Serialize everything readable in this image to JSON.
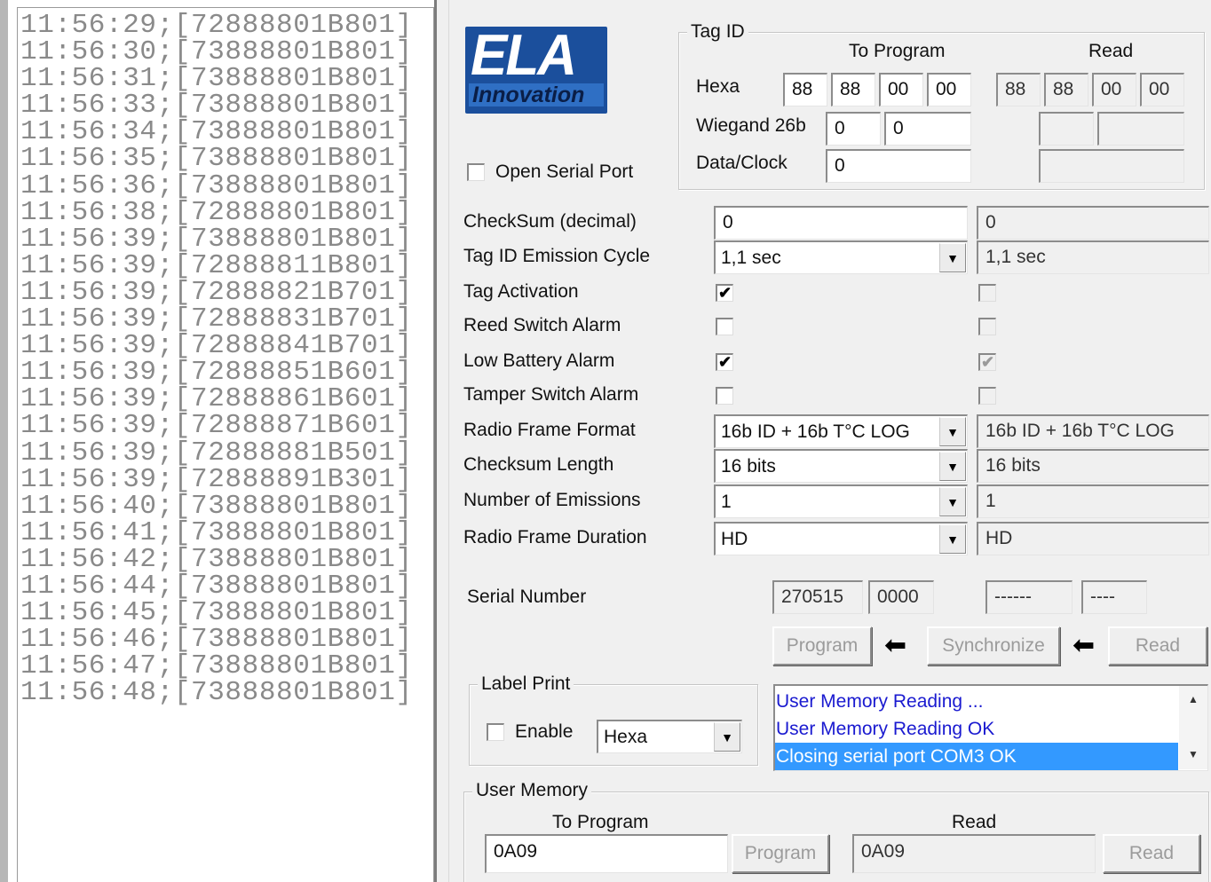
{
  "log": {
    "lines": [
      "11:56:29;[72888801B801]",
      "11:56:30;[73888801B801]",
      "11:56:31;[73888801B801]",
      "11:56:33;[73888801B801]",
      "11:56:34;[73888801B801]",
      "11:56:35;[73888801B801]",
      "11:56:36;[73888801B801]",
      "11:56:38;[72888801B801]",
      "11:56:39;[73888801B801]",
      "11:56:39;[72888811B801]",
      "11:56:39;[72888821B701]",
      "11:56:39;[72888831B701]",
      "11:56:39;[72888841B701]",
      "11:56:39;[72888851B601]",
      "11:56:39;[72888861B601]",
      "11:56:39;[72888871B601]",
      "11:56:39;[72888881B501]",
      "11:56:39;[72888891B301]",
      "11:56:40;[73888801B801]",
      "11:56:41;[73888801B801]",
      "11:56:42;[73888801B801]",
      "11:56:44;[73888801B801]",
      "11:56:45;[73888801B801]",
      "11:56:46;[73888801B801]",
      "11:56:47;[73888801B801]",
      "11:56:48;[73888801B801]"
    ]
  },
  "logo": {
    "main": "ELA",
    "sub": "Innovation"
  },
  "open_serial_port": {
    "label": "Open Serial Port",
    "checked": false
  },
  "tag_id": {
    "title": "Tag ID",
    "col_program": "To Program",
    "col_read": "Read",
    "hexa_label": "Hexa",
    "hexa_program": [
      "88",
      "88",
      "00",
      "00"
    ],
    "hexa_read": [
      "88",
      "88",
      "00",
      "00"
    ],
    "wiegand_label": "Wiegand 26b",
    "wiegand_program": [
      "0",
      "0"
    ],
    "wiegand_read": [
      "",
      ""
    ],
    "dataclock_label": "Data/Clock",
    "dataclock_program": "0",
    "dataclock_read": ""
  },
  "settings": {
    "checksum_label": "CheckSum (decimal)",
    "checksum_program": "0",
    "checksum_read": "0",
    "emission_cycle_label": "Tag ID Emission Cycle",
    "emission_cycle_program": "1,1 sec",
    "emission_cycle_read": "1,1 sec",
    "tag_activation_label": "Tag Activation",
    "reed_switch_label": "Reed Switch Alarm",
    "low_battery_label": "Low Battery Alarm",
    "tamper_switch_label": "Tamper Switch Alarm",
    "radio_format_label": "Radio Frame Format",
    "radio_format_program": "16b ID + 16b T°C LOG",
    "radio_format_read": "16b ID + 16b T°C LOG",
    "checksum_length_label": "Checksum Length",
    "checksum_length_program": "16 bits",
    "checksum_length_read": "16 bits",
    "emissions_label": "Number of Emissions",
    "emissions_program": "1",
    "emissions_read": "1",
    "frame_duration_label": "Radio Frame Duration",
    "frame_duration_program": "HD",
    "frame_duration_read": "HD",
    "check_marks": {
      "checked": "✔",
      "unchecked": ""
    }
  },
  "checkbox_states": {
    "tag_activation": {
      "program": true,
      "read": false
    },
    "reed_switch": {
      "program": false,
      "read": false
    },
    "low_battery": {
      "program": true,
      "read": true
    },
    "tamper_switch": {
      "program": false,
      "read": false
    }
  },
  "serial": {
    "label": "Serial Number",
    "program": [
      "270515",
      "0000"
    ],
    "read": [
      "------",
      "----"
    ]
  },
  "actions": {
    "program_label": "Program",
    "synchronize_label": "Synchronize",
    "read_label": "Read",
    "arrow_glyph": "⬅"
  },
  "label_print": {
    "title": "Label Print",
    "enable_label": "Enable",
    "enabled": false,
    "format": "Hexa"
  },
  "status_log": [
    {
      "text": "User Memory Reading ...",
      "selected": false
    },
    {
      "text": "User Memory Reading OK",
      "selected": false
    },
    {
      "text": "Closing serial port COM3 OK",
      "selected": true
    }
  ],
  "user_memory": {
    "title": "User Memory",
    "col_program": "To Program",
    "col_read": "Read",
    "program_value": "0A09",
    "read_value": "0A09",
    "program_button": "Program",
    "read_button": "Read"
  },
  "colors": {
    "logo_blue": "#1b4f9c",
    "selection": "#3399ff",
    "status_text": "#1a1ad0",
    "log_text": "#8a8a8a"
  }
}
